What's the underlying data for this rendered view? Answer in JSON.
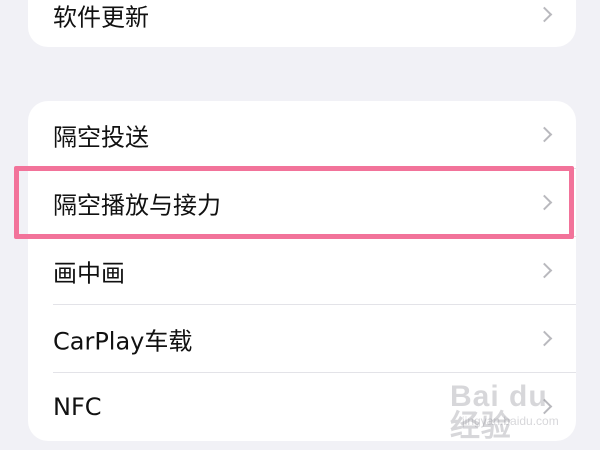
{
  "settings": {
    "top_group": {
      "items": [
        {
          "label": "软件更新"
        }
      ]
    },
    "main_group": {
      "items": [
        {
          "label": "隔空投送"
        },
        {
          "label": "隔空播放与接力",
          "highlighted": true
        },
        {
          "label": "画中画"
        },
        {
          "label": "CarPlay车载"
        },
        {
          "label": "NFC"
        }
      ]
    }
  },
  "annotation": {
    "highlight_color": "#f2739a"
  },
  "watermark": {
    "brand": "Bai du 经验",
    "site": "jingyan.baidu.com"
  },
  "icons": {
    "disclosure": "chevron-right-icon"
  }
}
